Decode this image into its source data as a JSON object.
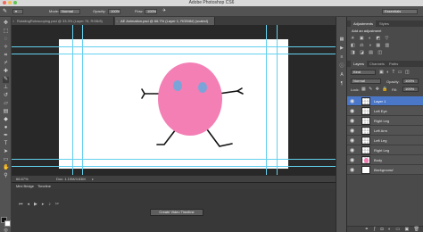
{
  "window": {
    "title": "Adobe Photoshop CS6"
  },
  "options_bar": {
    "mode_label": "Mode:",
    "mode_value": "Normal",
    "opacity_label": "Opacity:",
    "opacity_value": "100%",
    "flow_label": "Flow:",
    "flow_value": "100%",
    "workspace_value": "Essentials"
  },
  "tabs": [
    {
      "label": "RotatingRotoscoping.psd @ 33.3% (Layer 76, RGB/8)"
    },
    {
      "label": "AE Animation.psd @ 66.7% (Layer 1, RGB/8#) (scaled)"
    }
  ],
  "status": {
    "zoom": "66.67%",
    "doc": "Doc: 1.10M/4.63M"
  },
  "timeline": {
    "tabs": [
      "Mini Bridge",
      "Timeline"
    ],
    "create_button": "Create Video Timeline"
  },
  "adjustments_panel": {
    "tabs": [
      "Adjustments",
      "Styles"
    ],
    "heading": "Add an adjustment"
  },
  "layers_panel": {
    "tabs": [
      "Layers",
      "Channels",
      "Paths"
    ],
    "kind_label": "Kind",
    "blend_mode": "Normal",
    "opacity_label": "Opacity:",
    "opacity_value": "100%",
    "lock_label": "Lock:",
    "fill_label": "Fill:",
    "fill_value": "100%",
    "layers": [
      {
        "name": "Layer 1",
        "selected": true
      },
      {
        "name": "Left Eye",
        "selected": false
      },
      {
        "name": "Right Leg",
        "selected": false
      },
      {
        "name": "Left Arm",
        "selected": false
      },
      {
        "name": "Left Leg",
        "selected": false
      },
      {
        "name": "Right Leg",
        "selected": false
      },
      {
        "name": "Body",
        "selected": false
      },
      {
        "name": "Background",
        "selected": false
      }
    ]
  },
  "colors": {
    "body_pink": "#f37fb5",
    "eye_blue": "#7ba4d9",
    "guide_cyan": "#63d0ee",
    "selection_blue": "#4b77c9"
  }
}
